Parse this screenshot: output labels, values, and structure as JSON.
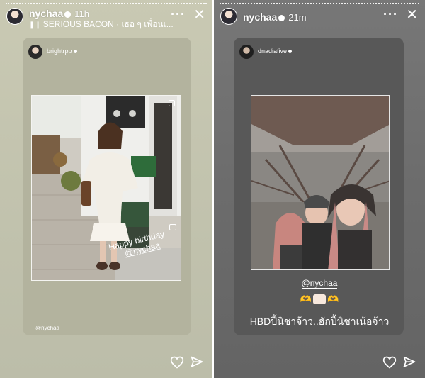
{
  "left_story": {
    "username": "nychaa",
    "time": "11h",
    "music_label": "SERIOUS BACON · เธอ ๆ เพื่อนเ...",
    "card_user": "brightrpp",
    "photo_text_line1": "Happy birthday",
    "photo_text_line2": "@nychaa",
    "mention_small": "@nychaa"
  },
  "right_story": {
    "username": "nychaa",
    "time": "21m",
    "card_user": "dnadiafive",
    "mention": "@nychaa",
    "caption": "HBDปี้นิชาจ้าว..ฮักปี้นิชาเน้อจ้าว"
  },
  "controls": {
    "more": "···",
    "close": "✕"
  },
  "colors": {
    "left_bg": "#c2c3ae",
    "right_bg": "#6c6c6c",
    "text": "#ffffff"
  },
  "icons": [
    "verified-badge-icon",
    "music-icon",
    "more-icon",
    "close-icon",
    "heart-icon",
    "send-icon",
    "cake-emoji-icon",
    "heart-hands-emoji-icon"
  ]
}
